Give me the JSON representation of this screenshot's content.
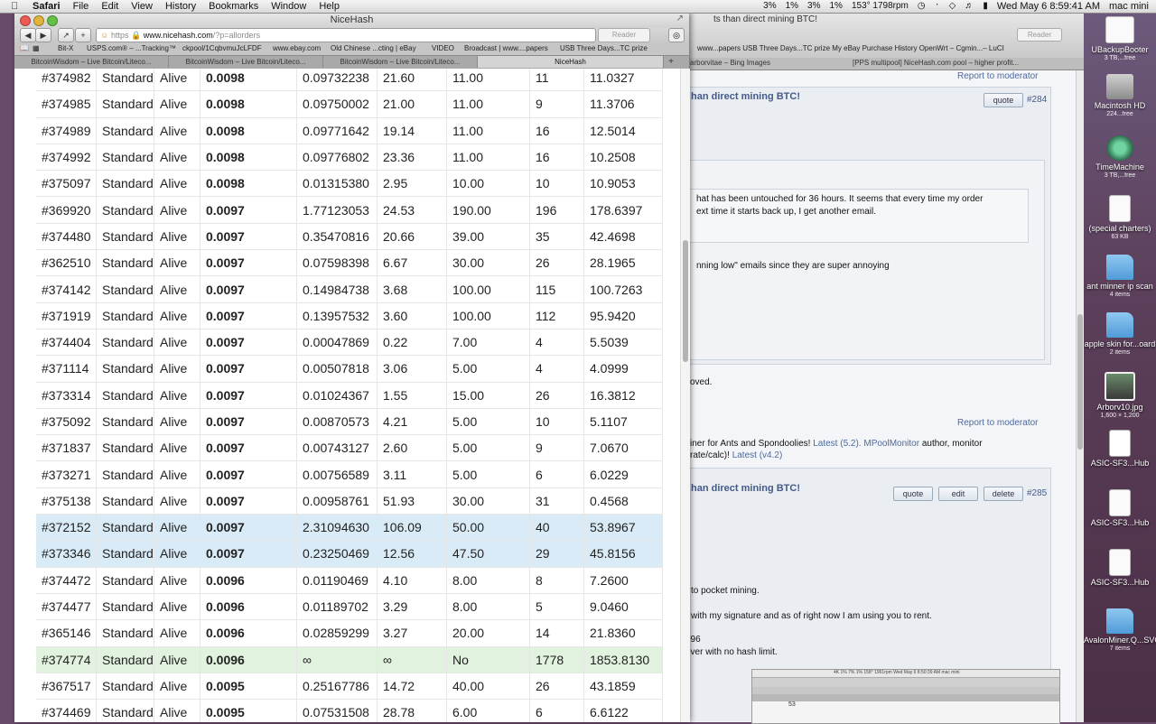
{
  "menubar": {
    "app": "Safari",
    "menus": [
      "File",
      "Edit",
      "View",
      "History",
      "Bookmarks",
      "Window",
      "Help"
    ],
    "status": [
      "3%",
      "1%",
      "3%",
      "1%",
      "153° 1798rpm"
    ],
    "clock": "Wed May 6  8:59:41 AM",
    "user": "mac mini"
  },
  "browser": {
    "window_title": "NiceHash",
    "url_scheme": "https",
    "url_host": "www.nicehash.com",
    "url_path": "/?p=allorders",
    "reader_label": "Reader",
    "bookmarks": [
      "Bit-X",
      "USPS.com® – ...Tracking™",
      "ckpool/1CqbvmuJcLFDF",
      "www.ebay.com",
      "Old Chinese ...cting | eBay",
      "VIDEO",
      "Broadcast | www....papers",
      "USB Three Days...TC prize"
    ],
    "tabs": [
      {
        "label": "BitcoinWisdom – Live Bitcoin/Liteco..."
      },
      {
        "label": "BitcoinWisdom – Live Bitcoin/Liteco..."
      },
      {
        "label": "BitcoinWisdom – Live Bitcoin/Liteco..."
      },
      {
        "label": "NiceHash"
      }
    ]
  },
  "orders": {
    "rows": [
      {
        "id": "#374982",
        "type": "Standard",
        "status": "Alive",
        "price": "0.0098",
        "btc": "0.09732238",
        "speed": "21.60",
        "limit": "11.00",
        "workers": "11",
        "accepted": "11.0327",
        "hl": ""
      },
      {
        "id": "#374985",
        "type": "Standard",
        "status": "Alive",
        "price": "0.0098",
        "btc": "0.09750002",
        "speed": "21.00",
        "limit": "11.00",
        "workers": "9",
        "accepted": "11.3706",
        "hl": ""
      },
      {
        "id": "#374989",
        "type": "Standard",
        "status": "Alive",
        "price": "0.0098",
        "btc": "0.09771642",
        "speed": "19.14",
        "limit": "11.00",
        "workers": "16",
        "accepted": "12.5014",
        "hl": ""
      },
      {
        "id": "#374992",
        "type": "Standard",
        "status": "Alive",
        "price": "0.0098",
        "btc": "0.09776802",
        "speed": "23.36",
        "limit": "11.00",
        "workers": "16",
        "accepted": "10.2508",
        "hl": ""
      },
      {
        "id": "#375097",
        "type": "Standard",
        "status": "Alive",
        "price": "0.0098",
        "btc": "0.01315380",
        "speed": "2.95",
        "limit": "10.00",
        "workers": "10",
        "accepted": "10.9053",
        "hl": ""
      },
      {
        "id": "#369920",
        "type": "Standard",
        "status": "Alive",
        "price": "0.0097",
        "btc": "1.77123053",
        "speed": "24.53",
        "limit": "190.00",
        "workers": "196",
        "accepted": "178.6397",
        "hl": ""
      },
      {
        "id": "#374480",
        "type": "Standard",
        "status": "Alive",
        "price": "0.0097",
        "btc": "0.35470816",
        "speed": "20.66",
        "limit": "39.00",
        "workers": "35",
        "accepted": "42.4698",
        "hl": ""
      },
      {
        "id": "#362510",
        "type": "Standard",
        "status": "Alive",
        "price": "0.0097",
        "btc": "0.07598398",
        "speed": "6.67",
        "limit": "30.00",
        "workers": "26",
        "accepted": "28.1965",
        "hl": ""
      },
      {
        "id": "#374142",
        "type": "Standard",
        "status": "Alive",
        "price": "0.0097",
        "btc": "0.14984738",
        "speed": "3.68",
        "limit": "100.00",
        "workers": "115",
        "accepted": "100.7263",
        "hl": ""
      },
      {
        "id": "#371919",
        "type": "Standard",
        "status": "Alive",
        "price": "0.0097",
        "btc": "0.13957532",
        "speed": "3.60",
        "limit": "100.00",
        "workers": "112",
        "accepted": "95.9420",
        "hl": ""
      },
      {
        "id": "#374404",
        "type": "Standard",
        "status": "Alive",
        "price": "0.0097",
        "btc": "0.00047869",
        "speed": "0.22",
        "limit": "7.00",
        "workers": "4",
        "accepted": "5.5039",
        "hl": ""
      },
      {
        "id": "#371114",
        "type": "Standard",
        "status": "Alive",
        "price": "0.0097",
        "btc": "0.00507818",
        "speed": "3.06",
        "limit": "5.00",
        "workers": "4",
        "accepted": "4.0999",
        "hl": ""
      },
      {
        "id": "#373314",
        "type": "Standard",
        "status": "Alive",
        "price": "0.0097",
        "btc": "0.01024367",
        "speed": "1.55",
        "limit": "15.00",
        "workers": "26",
        "accepted": "16.3812",
        "hl": ""
      },
      {
        "id": "#375092",
        "type": "Standard",
        "status": "Alive",
        "price": "0.0097",
        "btc": "0.00870573",
        "speed": "4.21",
        "limit": "5.00",
        "workers": "10",
        "accepted": "5.1107",
        "hl": ""
      },
      {
        "id": "#371837",
        "type": "Standard",
        "status": "Alive",
        "price": "0.0097",
        "btc": "0.00743127",
        "speed": "2.60",
        "limit": "5.00",
        "workers": "9",
        "accepted": "7.0670",
        "hl": ""
      },
      {
        "id": "#373271",
        "type": "Standard",
        "status": "Alive",
        "price": "0.0097",
        "btc": "0.00756589",
        "speed": "3.11",
        "limit": "5.00",
        "workers": "6",
        "accepted": "6.0229",
        "hl": ""
      },
      {
        "id": "#375138",
        "type": "Standard",
        "status": "Alive",
        "price": "0.0097",
        "btc": "0.00958761",
        "speed": "51.93",
        "limit": "30.00",
        "workers": "31",
        "accepted": "0.4568",
        "hl": ""
      },
      {
        "id": "#372152",
        "type": "Standard",
        "status": "Alive",
        "price": "0.0097",
        "btc": "2.31094630",
        "speed": "106.09",
        "limit": "50.00",
        "workers": "40",
        "accepted": "53.8967",
        "hl": "blue"
      },
      {
        "id": "#373346",
        "type": "Standard",
        "status": "Alive",
        "price": "0.0097",
        "btc": "0.23250469",
        "speed": "12.56",
        "limit": "47.50",
        "workers": "29",
        "accepted": "45.8156",
        "hl": "blue"
      },
      {
        "id": "#374472",
        "type": "Standard",
        "status": "Alive",
        "price": "0.0096",
        "btc": "0.01190469",
        "speed": "4.10",
        "limit": "8.00",
        "workers": "8",
        "accepted": "7.2600",
        "hl": ""
      },
      {
        "id": "#374477",
        "type": "Standard",
        "status": "Alive",
        "price": "0.0096",
        "btc": "0.01189702",
        "speed": "3.29",
        "limit": "8.00",
        "workers": "5",
        "accepted": "9.0460",
        "hl": ""
      },
      {
        "id": "#365146",
        "type": "Standard",
        "status": "Alive",
        "price": "0.0096",
        "btc": "0.02859299",
        "speed": "3.27",
        "limit": "20.00",
        "workers": "14",
        "accepted": "21.8360",
        "hl": ""
      },
      {
        "id": "#374774",
        "type": "Standard",
        "status": "Alive",
        "price": "0.0096",
        "btc": "∞",
        "speed": "∞",
        "limit": "No",
        "workers": "1778",
        "accepted": "1853.8130",
        "hl": "green"
      },
      {
        "id": "#367517",
        "type": "Standard",
        "status": "Alive",
        "price": "0.0095",
        "btc": "0.25167786",
        "speed": "14.72",
        "limit": "40.00",
        "workers": "26",
        "accepted": "43.1859",
        "hl": ""
      },
      {
        "id": "#374469",
        "type": "Standard",
        "status": "Alive",
        "price": "0.0095",
        "btc": "0.07531508",
        "speed": "28.78",
        "limit": "6.00",
        "workers": "6",
        "accepted": "6.6122",
        "hl": ""
      }
    ]
  },
  "background_window": {
    "title_fragment": "ts than direct mining BTC!",
    "reader_label": "Reader",
    "bookmarks": "www...papers   USB Three Days...TC prize   My eBay Purchase History   OpenWrt – Cgmin...– LuCI",
    "tabs": [
      "arborvitae – Bing Images",
      "[PPS multipool] NiceHash.com pool – higher profit..."
    ],
    "report1": "Report to moderator",
    "post1_title": "han direct mining BTC!",
    "post1_num": "#284",
    "quote_label": "quote",
    "post1_line1": "hat has been untouched for 36 hours.  It seems that every time my order",
    "post1_line2": "ext time it starts back up, I get another email.",
    "post1_line3": "nning low\" emails since they are super annoying",
    "post1_line4": "oved.",
    "report2": "Report to moderator",
    "sig_line1_a": "iner for Ants and Spondoolies!",
    "sig_line1_b": "Latest (5.2).",
    "sig_line1_c": "MPoolMonitor",
    "sig_line1_d": "author, monitor",
    "sig_line2_a": "rate/calc)!",
    "sig_line2_b": "Latest (v4.2)",
    "post2_title": "han direct mining BTC!",
    "post2_num": "#285",
    "edit_label": "edit",
    "delete_label": "delete",
    "post2_line1": "to pocket mining.",
    "post2_line2": "with my signature and as of right now I am using you to rent.",
    "post2_line3": "096",
    "post2_line4": "ever with no hash limit.",
    "thumb_menubar": "4K  1%  7%  1%  158° 1961rpm  Wed May 6  8:50:39 AM  mac mini",
    "thumb_num": "53"
  },
  "desktop": {
    "icons": [
      {
        "name": "UBackupBooter",
        "sub": "3 TB,...free"
      },
      {
        "name": "Macintosh HD",
        "sub": "224...free"
      },
      {
        "name": "TimeMachine",
        "sub": "3 TB,...free"
      },
      {
        "name": "(special charters)",
        "sub": "63 KB"
      },
      {
        "name": "ant minner ip scan",
        "sub": "4 items"
      },
      {
        "name": "apple skin for...oard",
        "sub": "2 items"
      },
      {
        "name": "Arborv10.jpg",
        "sub": "1,600 × 1,200"
      },
      {
        "name": "ASIC-SF3...Hub",
        "sub": ""
      },
      {
        "name": "ASIC-SF3...Hub",
        "sub": ""
      },
      {
        "name": "ASIC-SF3...Hub",
        "sub": ""
      },
      {
        "name": "AvalonMiner.Q...SVC",
        "sub": "7 items"
      }
    ]
  }
}
